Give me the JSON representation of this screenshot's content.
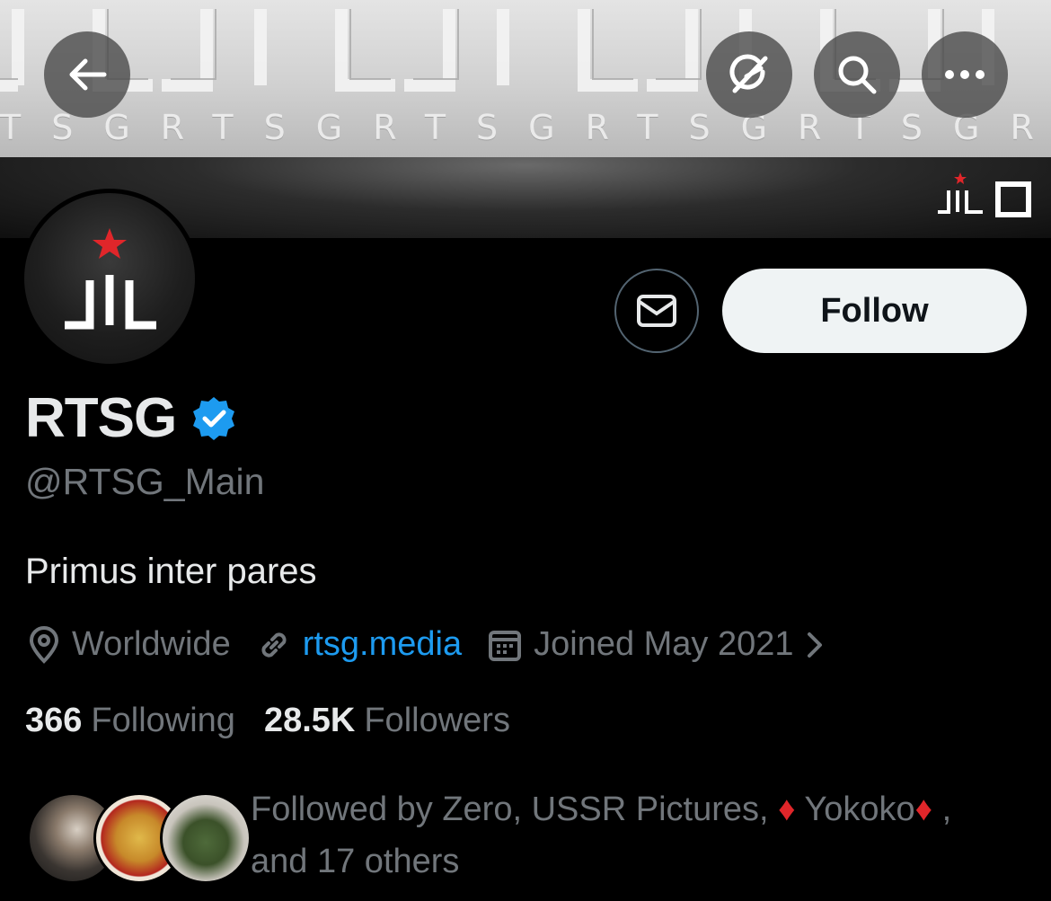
{
  "banner": {
    "wordmark": "TSGRTSGRTSGRTSGRTSGRTS",
    "logo_text": "JIL"
  },
  "top_actions": {
    "back": "arrow-left-icon",
    "explore": "grok-icon",
    "search": "search-icon",
    "more": "more-icon"
  },
  "profile": {
    "display_name": "RTSG",
    "verified": true,
    "handle": "@RTSG_Main",
    "bio": "Primus inter pares",
    "location": "Worldwide",
    "website": "rtsg.media",
    "joined": "Joined May 2021",
    "follow_label": "Follow"
  },
  "stats": {
    "following_count": "366",
    "following_label": "Following",
    "followers_count": "28.5K",
    "followers_label": "Followers"
  },
  "followed_by": {
    "prefix": "Followed by ",
    "name1": "Zero",
    "sep1": ", ",
    "name2": "USSR Pictures",
    "sep2": ", ",
    "diamond_left": "♦",
    "name3": " Yokoko",
    "diamond_right": "♦",
    "sep3": " ,",
    "suffix": "and 17 others"
  },
  "colors": {
    "background": "#000000",
    "text_primary": "#e7e9ea",
    "text_secondary": "#71767b",
    "link": "#1d9bf0",
    "verified": "#1d9bf0",
    "follow_bg": "#eff3f4",
    "accent_red": "#e0262a"
  }
}
